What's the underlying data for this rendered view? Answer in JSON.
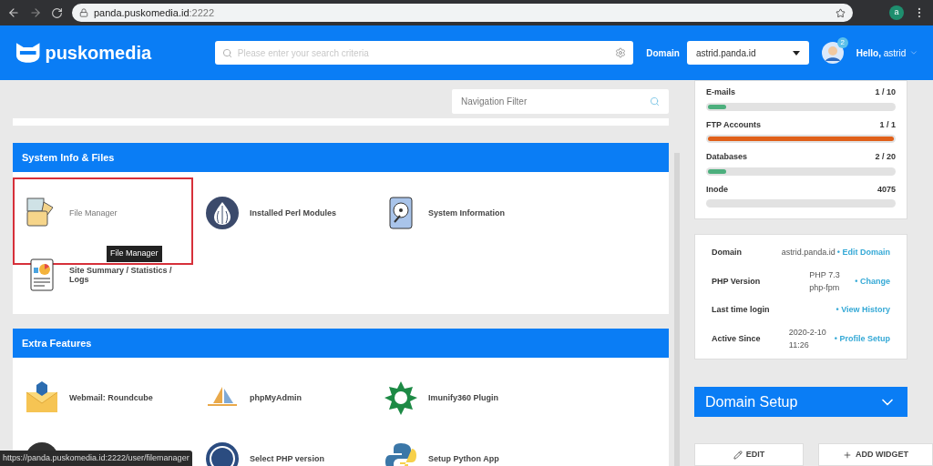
{
  "browser": {
    "url_host": "panda.puskomedia.id",
    "url_port": ":2222",
    "profile_initial": "a"
  },
  "header": {
    "logo": "puskomedia",
    "search_placeholder": "Please enter your search criteria",
    "domain_label": "Domain",
    "domain_value": "astrid.panda.id",
    "notification_count": "2",
    "greeting": "Hello,",
    "username": "astrid"
  },
  "nav_filter": {
    "placeholder": "Navigation Filter"
  },
  "sections": [
    {
      "title": "System Info & Files",
      "items": [
        {
          "kind": "files",
          "label": "File Manager",
          "highlighted": true,
          "tooltip": "File Manager"
        },
        {
          "kind": "onion",
          "label": "Installed Perl Modules",
          "highlighted": false
        },
        {
          "kind": "disk",
          "label": "System Information",
          "highlighted": false
        },
        {
          "kind": "report",
          "label": "Site Summary / Statistics / Logs",
          "highlighted": false
        }
      ]
    },
    {
      "title": "Extra Features",
      "items": [
        {
          "kind": "mail",
          "label": "Webmail: Roundcube",
          "highlighted": false
        },
        {
          "kind": "sails",
          "label": "phpMyAdmin",
          "highlighted": false
        },
        {
          "kind": "star",
          "label": "Imunify360 Plugin",
          "highlighted": false
        },
        {
          "kind": "dark-circle",
          "highlighted": false
        },
        {
          "kind": "gauge",
          "label": "Select PHP version",
          "highlighted": false
        },
        {
          "kind": "python",
          "label": "Setup Python App",
          "highlighted": false
        }
      ]
    }
  ],
  "usage": [
    {
      "label": "E-mails",
      "reading": "1 / 10",
      "level": 0.1,
      "color": "#4caf7d"
    },
    {
      "label": "FTP Accounts",
      "reading": "1 / 1",
      "level": 1,
      "color": "#e0601a"
    },
    {
      "label": "Databases",
      "reading": "2 / 20",
      "level": 0.1,
      "color": "#4caf7d"
    },
    {
      "label": "Inode",
      "reading": "4075",
      "level": 0
    }
  ],
  "info": [
    {
      "label": "Domain",
      "value": "astrid.panda.id",
      "link": "• Edit Domain"
    },
    {
      "label": "PHP Version",
      "value": "PHP 7.3 php-fpm",
      "link": "• Change"
    },
    {
      "label": "Last time login",
      "link": "• View History"
    },
    {
      "label": "Active Since",
      "value": "2020-2-10 11:26",
      "link": "• Profile Setup"
    }
  ],
  "domain_setup": {
    "title": "Domain Setup"
  },
  "buttons": [
    {
      "kind": "edit",
      "label": "EDIT"
    },
    {
      "kind": "add",
      "label": "ADD WIDGET"
    }
  ],
  "status_url": "https://panda.puskomedia.id:2222/user/filemanager"
}
